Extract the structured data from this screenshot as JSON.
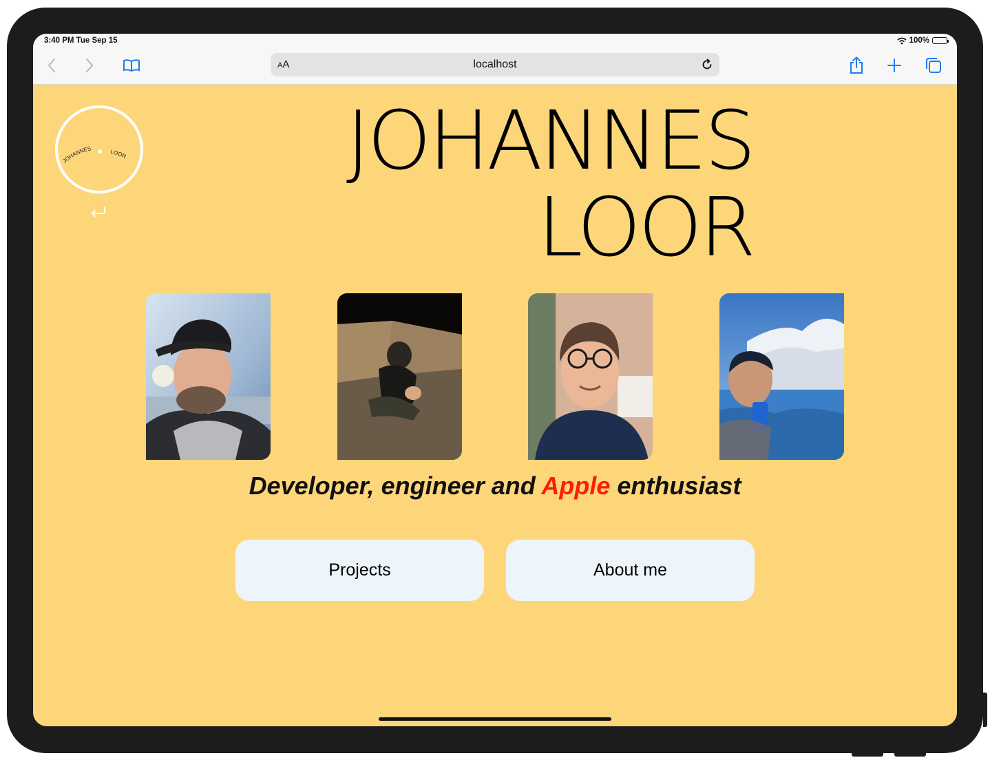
{
  "status": {
    "time": "3:40 PM   Tue Sep 15",
    "battery": "100%"
  },
  "toolbar": {
    "text_size_label": "AA",
    "url": "localhost"
  },
  "logo": {
    "first": "JOHANNES",
    "last": "LOOR"
  },
  "hero": {
    "line1": "JOHANNES",
    "line2": "LOOR"
  },
  "tagline": {
    "before": "Developer, engineer and ",
    "accent": "Apple",
    "after": " enthusiast"
  },
  "buttons": {
    "projects": "Projects",
    "about": "About me"
  },
  "colors": {
    "background": "#fed67a",
    "accent": "#ff1c0a",
    "button": "#edf5fb",
    "toolbar_tint": "#1a7cf0"
  },
  "icons": [
    "back-arrow-icon",
    "forward-arrow-icon",
    "bookmarks-icon",
    "reload-icon",
    "share-icon",
    "new-tab-icon",
    "tabs-icon",
    "return-arrow-icon"
  ]
}
